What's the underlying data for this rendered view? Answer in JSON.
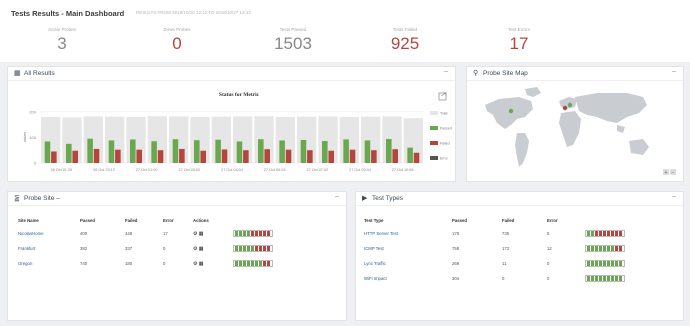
{
  "header": {
    "title": "Tests Results - Main Dashboard",
    "subtitle": "RESULTS FROM 2018/10/26 12:12 TO 2018/10/27 12:13"
  },
  "stats": [
    {
      "label": "Active Probes",
      "value": "3",
      "color": "grey"
    },
    {
      "label": "Down Probes",
      "value": "0",
      "color": "red"
    },
    {
      "label": "Tests Passed",
      "value": "1503",
      "color": "grey"
    },
    {
      "label": "Tests Failed",
      "value": "925",
      "color": "red"
    },
    {
      "label": "Test Errors",
      "value": "17",
      "color": "red"
    }
  ],
  "panels": {
    "all_results": "All Results",
    "probe_map": "Probe Site Map",
    "probe_site": "Probe Site –",
    "test_types": "Test Types",
    "minimize": "–"
  },
  "chart_data": {
    "type": "bar",
    "title": "Status for Metric",
    "ylabel": "values",
    "ylim": [
      0,
      250
    ],
    "yticks": [
      "200",
      "100",
      "0"
    ],
    "xticks": [
      "26 Oct 21:25",
      "26 Oct 23:12",
      "27 Oct 01:00",
      "27 Oct 03:00",
      "27 Oct 04:04",
      "27 Oct 06:03",
      "27 Oct 07:02",
      "27 Oct 09:04",
      "27 Oct 10:58"
    ],
    "legend": [
      "Total",
      "Passed",
      "Failed",
      "Error"
    ],
    "colors": {
      "total": "#e6e6e6",
      "passed": "#6aa84f",
      "failed": "#b5463f",
      "error": "#555555"
    },
    "series": [
      {
        "name": "Passed",
        "values": [
          84,
          75,
          95,
          88,
          92,
          85,
          93,
          89,
          91,
          84,
          93,
          88,
          90,
          86,
          92,
          88,
          94,
          60
        ]
      },
      {
        "name": "Failed",
        "values": [
          45,
          48,
          55,
          52,
          52,
          50,
          55,
          48,
          53,
          50,
          54,
          52,
          50,
          48,
          52,
          50,
          54,
          40
        ]
      },
      {
        "name": "Total",
        "values": [
          180,
          178,
          182,
          181,
          180,
          183,
          182,
          180,
          181,
          182,
          183,
          180,
          181,
          182,
          180,
          181,
          182,
          175
        ]
      }
    ]
  },
  "probe_table": {
    "headers": [
      "Site Name",
      "Passed",
      "Failed",
      "Error",
      "Actions",
      ""
    ],
    "rows": [
      {
        "name": "NicolasHome",
        "passed": "400",
        "failed": "448",
        "error": "17"
      },
      {
        "name": "Frankfurt",
        "passed": "382",
        "failed": "337",
        "error": "0"
      },
      {
        "name": "Oregon",
        "passed": "740",
        "failed": "180",
        "error": "0"
      }
    ]
  },
  "types_table": {
    "headers": [
      "Test Type",
      "Passed",
      "Failed",
      "Error",
      ""
    ],
    "rows": [
      {
        "name": "HTTP Server Test",
        "passed": "178",
        "failed": "735",
        "error": "5"
      },
      {
        "name": "ICMP Test",
        "passed": "758",
        "failed": "173",
        "error": "12"
      },
      {
        "name": "Lync Traffic",
        "passed": "269",
        "failed": "11",
        "error": "0"
      },
      {
        "name": "WiFi Impact",
        "passed": "304",
        "failed": "0",
        "error": "0"
      }
    ]
  }
}
